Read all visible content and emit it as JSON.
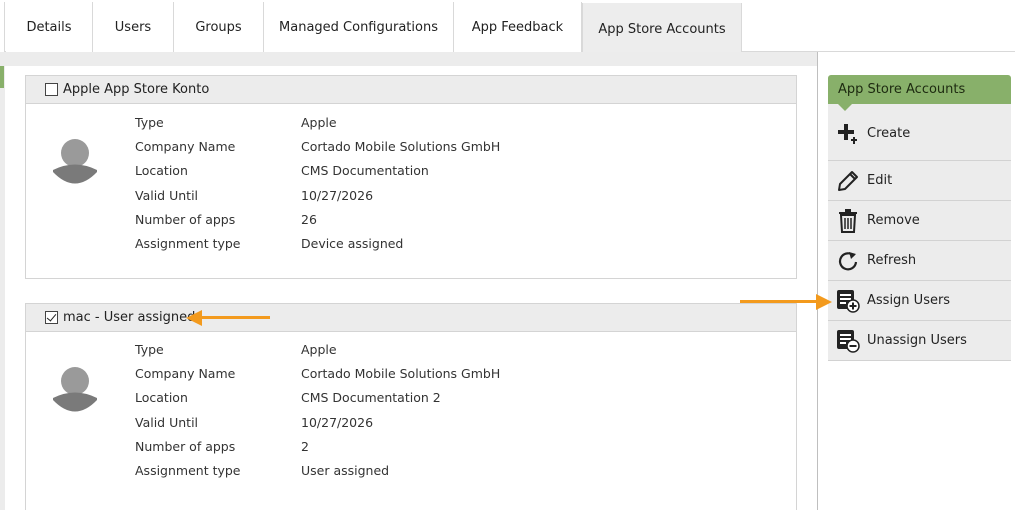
{
  "tabs": [
    {
      "label": "Details",
      "active": false
    },
    {
      "label": "Users",
      "active": false
    },
    {
      "label": "Groups",
      "active": false
    },
    {
      "label": "Managed Configurations",
      "active": false
    },
    {
      "label": "App Feedback",
      "active": false
    },
    {
      "label": "App Store Accounts",
      "active": true
    }
  ],
  "accounts": [
    {
      "title": "Apple App Store Konto",
      "checked": false,
      "properties": [
        {
          "label": "Type",
          "value": "Apple"
        },
        {
          "label": "Company Name",
          "value": "Cortado Mobile Solutions GmbH"
        },
        {
          "label": "Location",
          "value": "CMS Documentation"
        },
        {
          "label": "Valid Until",
          "value": "10/27/2026"
        },
        {
          "label": "Number of apps",
          "value": "26"
        },
        {
          "label": "Assignment type",
          "value": "Device assigned"
        }
      ]
    },
    {
      "title": "mac - User assigned",
      "checked": true,
      "properties": [
        {
          "label": "Type",
          "value": "Apple"
        },
        {
          "label": "Company Name",
          "value": "Cortado Mobile Solutions GmbH"
        },
        {
          "label": "Location",
          "value": "CMS Documentation 2"
        },
        {
          "label": "Valid Until",
          "value": "10/27/2026"
        },
        {
          "label": "Number of apps",
          "value": "2"
        },
        {
          "label": "Assignment type",
          "value": "User assigned"
        }
      ]
    }
  ],
  "actions_panel": {
    "title": "App Store Accounts",
    "items": [
      {
        "label": "Create",
        "icon": "plus-icon"
      },
      {
        "label": "Edit",
        "icon": "pencil-icon"
      },
      {
        "label": "Remove",
        "icon": "trash-icon"
      },
      {
        "label": "Refresh",
        "icon": "refresh-icon"
      },
      {
        "label": "Assign Users",
        "icon": "assign-users-icon"
      },
      {
        "label": "Unassign Users",
        "icon": "unassign-users-icon"
      }
    ]
  },
  "colors": {
    "accent_green": "#88b06a",
    "arrow_orange": "#f39a1d",
    "panel_gray": "#ececec"
  }
}
